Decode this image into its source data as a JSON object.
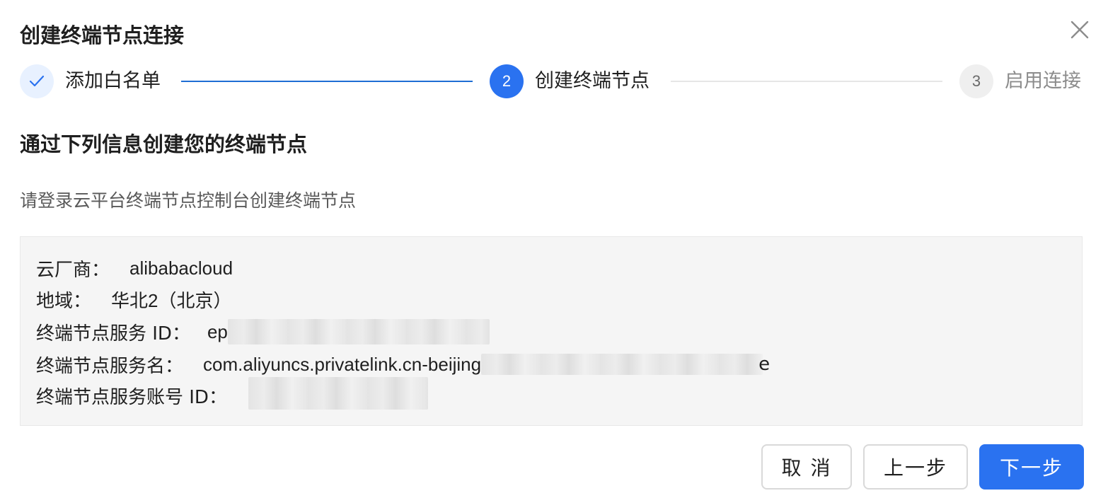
{
  "dialog": {
    "title": "创建终端节点连接",
    "close_icon": "close-icon"
  },
  "steps": [
    {
      "label": "添加白名单",
      "status": "done",
      "icon": "check-icon"
    },
    {
      "label": "创建终端节点",
      "status": "current",
      "number": "2"
    },
    {
      "label": "启用连接",
      "status": "pending",
      "number": "3"
    }
  ],
  "section": {
    "heading": "通过下列信息创建您的终端节点",
    "description": "请登录云平台终端节点控制台创建终端节点"
  },
  "info": {
    "provider_label": "云厂商：",
    "provider_value": "alibabacloud",
    "region_label": "地域：",
    "region_value": "华北2（北京）",
    "service_id_label": "终端节点服务 ID：",
    "service_id_value": "ep",
    "service_name_label": "终端节点服务名：",
    "service_name_value": "com.aliyuncs.privatelink.cn-beijing",
    "service_name_tail": "e",
    "account_id_label": "终端节点服务账号 ID："
  },
  "footer": {
    "cancel_label": "取 消",
    "prev_label": "上一步",
    "next_label": "下一步"
  },
  "colors": {
    "primary": "#2a72f0",
    "step_done_bg": "#e8f1ff",
    "box_bg": "#f5f5f5"
  }
}
